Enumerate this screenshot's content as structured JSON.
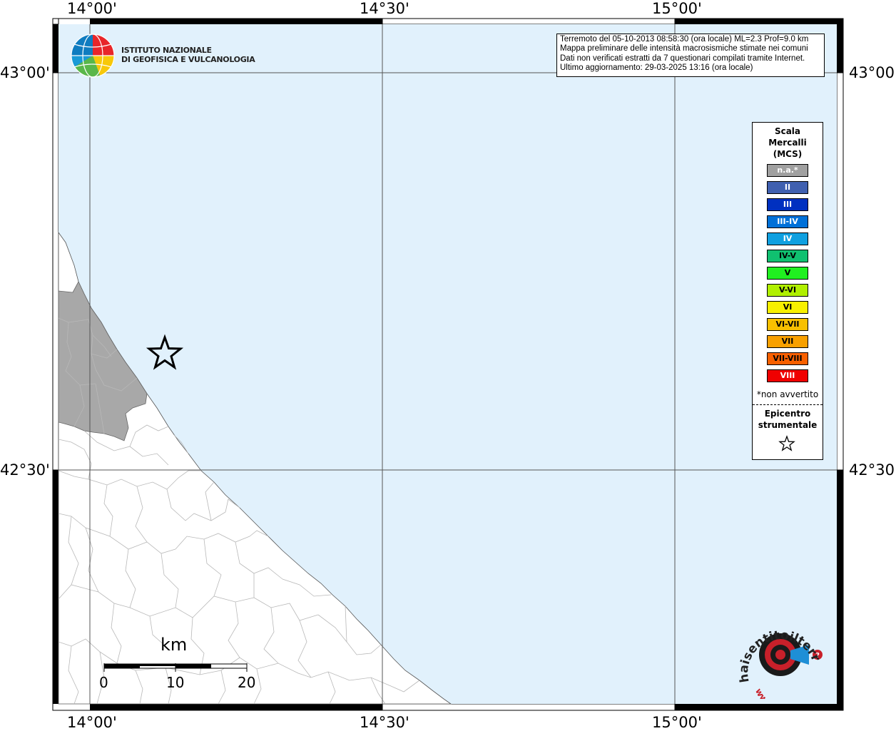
{
  "institute": {
    "line1": "ISTITUTO NAZIONALE",
    "line2": "DI GEOFISICA E VULCANOLOGIA"
  },
  "info": {
    "line1": "Terremoto del 05-10-2013 08:58:30 (ora locale) ML=2.3 Prof=9.0 km",
    "line2": "Mappa preliminare delle intensità macrosismiche stimate nei comuni",
    "line3": "Dati non verificati estratti da 7 questionari compilati tramite Internet.",
    "line4": "Ultimo aggiornamento: 29-03-2025 13:16 (ora locale)"
  },
  "axes": {
    "top": [
      "14°00'",
      "14°30'",
      "15°00'"
    ],
    "bottom": [
      "14°00'",
      "14°30'",
      "15°00'"
    ],
    "left": [
      "43°00'",
      "42°30'"
    ],
    "right": [
      "43°00'",
      "42°30'"
    ]
  },
  "legend": {
    "title_l1": "Scala",
    "title_l2": "Mercalli",
    "title_l3": "(MCS)",
    "items": [
      {
        "label": "n.a.*",
        "color": "#a0a0a0",
        "text_color": "#ffffff"
      },
      {
        "label": "II",
        "color": "#4060b0",
        "text_color": "#ffffff"
      },
      {
        "label": "III",
        "color": "#0030c0",
        "text_color": "#ffffff"
      },
      {
        "label": "III-IV",
        "color": "#0070d8",
        "text_color": "#ffffff"
      },
      {
        "label": "IV",
        "color": "#10a0e0",
        "text_color": "#ffffff"
      },
      {
        "label": "IV-V",
        "color": "#10c070",
        "text_color": "#000000"
      },
      {
        "label": "V",
        "color": "#20f020",
        "text_color": "#000000"
      },
      {
        "label": "V-VI",
        "color": "#b0f000",
        "text_color": "#000000"
      },
      {
        "label": "VI",
        "color": "#f8f000",
        "text_color": "#000000"
      },
      {
        "label": "VI-VII",
        "color": "#f8c000",
        "text_color": "#000000"
      },
      {
        "label": "VII",
        "color": "#f8a000",
        "text_color": "#000000"
      },
      {
        "label": "VII-VIII",
        "color": "#f86000",
        "text_color": "#000000"
      },
      {
        "label": "VIII",
        "color": "#f00000",
        "text_color": "#ffffff"
      }
    ],
    "note": "*non avvertito",
    "epi_l1": "Epicentro",
    "epi_l2": "strumentale"
  },
  "scale": {
    "unit": "km",
    "ticks": [
      "0",
      "10",
      "20"
    ]
  },
  "hs_logo": {
    "text": "haisentitoilterremoto.it",
    "prefix": "www."
  },
  "colors": {
    "sea": "#e1f1fc",
    "land": "#ffffff",
    "felt_area": "#a8a8a8",
    "frame": "#000000"
  }
}
